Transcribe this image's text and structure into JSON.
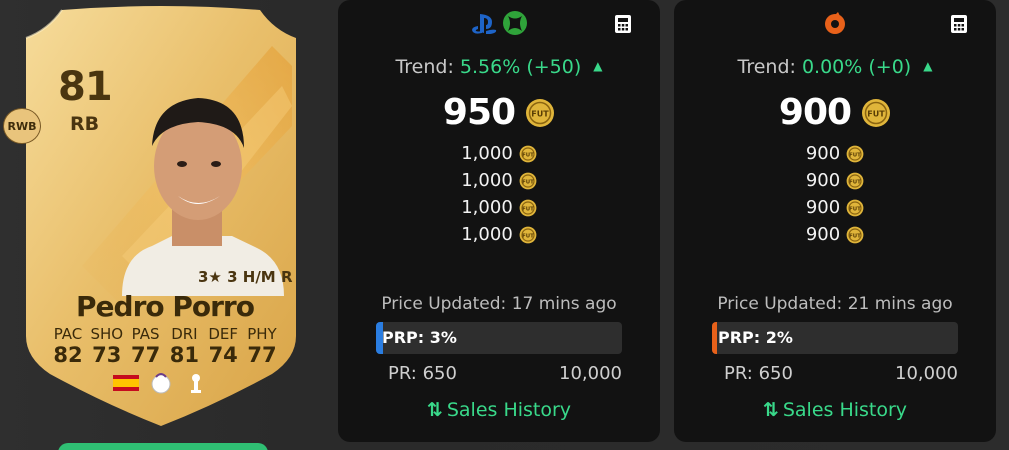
{
  "player": {
    "rating": "81",
    "position": "RB",
    "alt_position": "RWB",
    "skills": "3★ 3 H/M R",
    "name": "Pedro Porro",
    "stats": [
      {
        "label": "PAC",
        "value": "82"
      },
      {
        "label": "SHO",
        "value": "73"
      },
      {
        "label": "PAS",
        "value": "77"
      },
      {
        "label": "DRI",
        "value": "81"
      },
      {
        "label": "DEF",
        "value": "74"
      },
      {
        "label": "PHY",
        "value": "77"
      }
    ],
    "nation_icon": "spain-flag-icon",
    "league_icon": "premier-league-icon",
    "club_icon": "tottenham-crest-icon"
  },
  "panels": [
    {
      "platform_icons": [
        "playstation-icon",
        "xbox-icon"
      ],
      "trend_label": "Trend:",
      "trend_value": "5.56% (+50)",
      "price": "950",
      "listings": [
        "1,000",
        "1,000",
        "1,000",
        "1,000"
      ],
      "updated": "Price Updated: 17 mins ago",
      "prp_label": "PRP: 3%",
      "prp_percent": 3,
      "prp_color": "#2a7de1",
      "pr_min": "PR: 650",
      "pr_max": "10,000",
      "sales_label": "Sales History"
    },
    {
      "platform_icons": [
        "origin-icon"
      ],
      "trend_label": "Trend:",
      "trend_value": "0.00% (+0)",
      "price": "900",
      "listings": [
        "900",
        "900",
        "900",
        "900"
      ],
      "updated": "Price Updated: 21 mins ago",
      "prp_label": "PRP: 2%",
      "prp_percent": 2,
      "prp_color": "#e8611a",
      "pr_min": "PR: 650",
      "pr_max": "10,000",
      "sales_label": "Sales History"
    }
  ],
  "colors": {
    "accent_green": "#39d98a",
    "coin_gold": "#e0b53a",
    "card_gold": "#e3b65c"
  }
}
